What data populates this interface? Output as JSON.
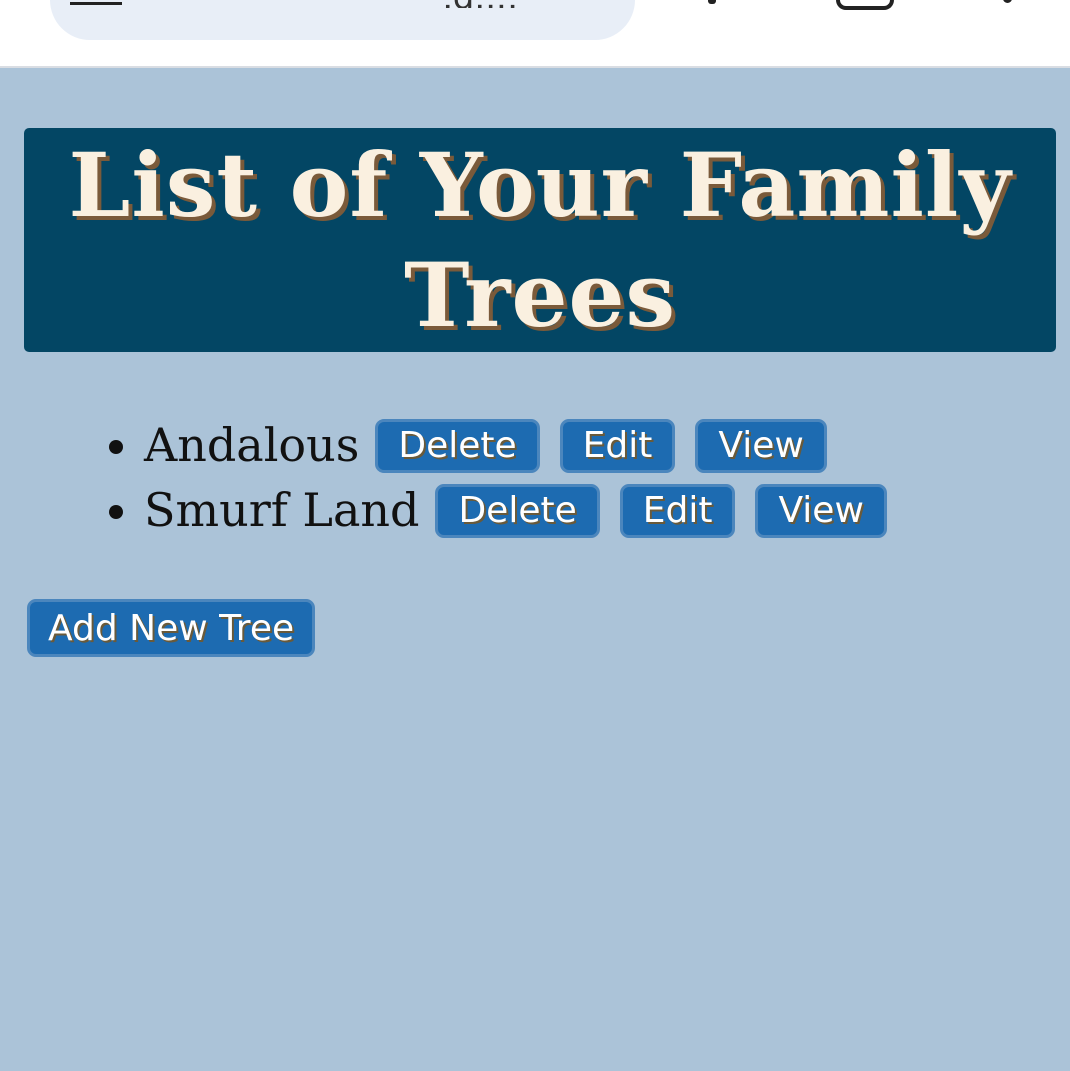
{
  "browser": {
    "url_fragment": ",g...,"
  },
  "header": {
    "title": "List of Your Family Trees"
  },
  "trees": [
    {
      "name": "Andalous",
      "delete_label": "Delete",
      "edit_label": "Edit",
      "view_label": "View"
    },
    {
      "name": "Smurf Land",
      "delete_label": "Delete",
      "edit_label": "Edit",
      "view_label": "View"
    }
  ],
  "actions": {
    "add_label": "Add New Tree"
  },
  "colors": {
    "page_bg": "#abc3d8",
    "banner_bg": "#034664",
    "title_text": "#faf0e0",
    "button_bg": "#1d6bb1"
  },
  "icons": {
    "menu": "hamburger-menu-icon",
    "tabs": "tab-switcher-icon",
    "more": "more-options-icon"
  }
}
